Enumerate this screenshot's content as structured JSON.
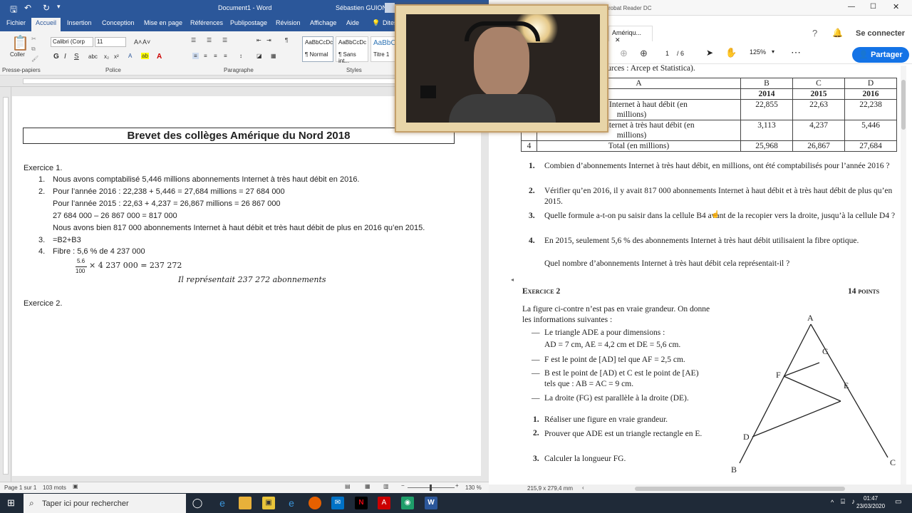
{
  "word": {
    "window_title": "Document1 - Word",
    "user": "Sébastien GUION",
    "tabs": [
      "Fichier",
      "Accueil",
      "Insertion",
      "Conception",
      "Mise en page",
      "Références",
      "Publipostage",
      "Révision",
      "Affichage",
      "Aide",
      "Dites"
    ],
    "active_tab": "Accueil",
    "ribbon": {
      "paste": "Coller",
      "font_name": "Calibri (Corp",
      "font_size": "11",
      "groups": [
        "Presse-papiers",
        "Police",
        "Paragraphe",
        "Styles"
      ],
      "styles": [
        {
          "preview": "AaBbCcDc",
          "name": "¶ Normal"
        },
        {
          "preview": "AaBbCcDc",
          "name": "¶ Sans int..."
        },
        {
          "preview": "AaBbC",
          "name": "Titre 1"
        }
      ]
    },
    "document": {
      "title": "Brevet des collèges Amérique du Nord 2018",
      "lines": [
        "Exercice 1.",
        "1.",
        "Nous avons comptabilisé 5,446 millions abonnements Internet à très haut débit en 2016.",
        "2.",
        "Pour l’année 2016 : 22,238 + 5,446 = 27,684 millions = 27 684 000",
        "Pour l’année 2015 : 22,63 + 4,237 = 26,867 millions = 26 867 000",
        "27 684 000 – 26 867 000 = 817 000",
        "Nous avons bien 817 000 abonnements Internet à haut débit et très haut débit de plus en 2016 qu’en 2015.",
        "3.",
        "=B2+B3",
        "4.",
        "Fibre : 5,6 % de 4 237 000",
        "5.6",
        "100",
        "× 4 237 000 = 237 272",
        "Il représentait 237 272 abonnements",
        "Exercice 2."
      ]
    },
    "status": {
      "page": "Page 1 sur 1",
      "words": "103 mots",
      "zoom": "130 %"
    }
  },
  "acrobat": {
    "window_title": "crobat Reader DC",
    "tab": "Amériqu...",
    "connect": "Se connecter",
    "share": "Partager",
    "page_current": "1",
    "page_total": "/ 6",
    "zoom": "125%",
    "pdf": {
      "sources": "Sources : Arcep et Statistica).",
      "table": {
        "header": [
          "A",
          "B",
          "C",
          "D"
        ],
        "rows": [
          [
            "",
            "",
            "2014",
            "2015",
            "2016"
          ],
          [
            "",
            "nnements Internet à haut débit (en millions)",
            "22,855",
            "22,63",
            "22,238"
          ],
          [
            "",
            "nnements Internet à très haut débit (en millions)",
            "3,113",
            "4,237",
            "5,446"
          ],
          [
            "4",
            "Total (en millions)",
            "25,968",
            "26,867",
            "27,684"
          ]
        ]
      },
      "questions": [
        {
          "n": "1.",
          "text": "Combien d’abonnements Internet à très haut débit, en millions, ont été comptabilisés pour l’année 2016 ?"
        },
        {
          "n": "2.",
          "text": "Vérifier qu’en 2016, il y avait 817 000 abonnements Internet à haut débit et à très haut débit de plus qu’en 2015."
        },
        {
          "n": "3.",
          "text": "Quelle formule a-t-on pu saisir dans la cellule B4 avant de la recopier vers la droite, jusqu’à la cellule D4 ?"
        },
        {
          "n": "4.",
          "text": "En 2015, seulement 5,6 % des abonnements Internet à très haut débit utilisaient la fibre optique."
        },
        {
          "n": "",
          "text": "Quel nombre d’abonnements Internet à très haut débit cela représentait-il ?"
        }
      ],
      "ex2_title": "Exercice 2",
      "ex2_points": "14 points",
      "ex2_intro": "La figure ci-contre n’est pas en vraie grandeur. On donne les informations suivantes :",
      "ex2_items": [
        "Le triangle ADE a pour dimensions :",
        "AD = 7 cm, AE = 4,2 cm et DE = 5,6 cm.",
        "F est le point de [AD] tel que AF = 2,5 cm.",
        "B est le point de [AD) et C est le point de [AE)",
        "tels que : AB = AC = 9 cm.",
        "La droite (FG) est parallèle à la droite (DE)."
      ],
      "ex2_questions": [
        {
          "n": "1.",
          "text": "Réaliser une figure en vraie grandeur."
        },
        {
          "n": "2.",
          "text": "Prouver que ADE est un triangle rectangle en E."
        },
        {
          "n": "3.",
          "text": "Calculer la longueur FG."
        }
      ],
      "figure_labels": {
        "A": "A",
        "B": "B",
        "C": "C",
        "D": "D",
        "E": "E",
        "F": "F",
        "G": "G"
      }
    },
    "status_size": "215,9 x 279,4 mm"
  },
  "taskbar": {
    "search_placeholder": "Taper ici pour rechercher",
    "time": "01:47",
    "date": "23/03/2020"
  }
}
